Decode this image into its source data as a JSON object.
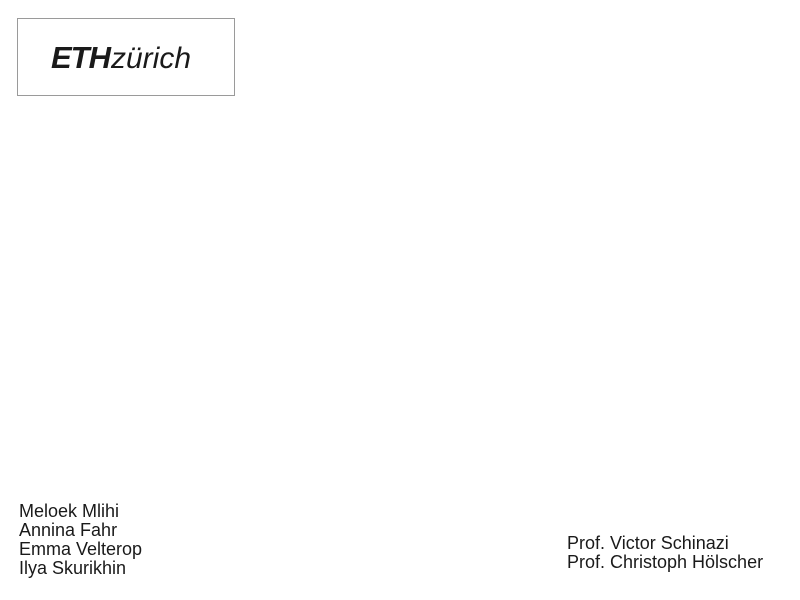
{
  "logo": {
    "wordmark_bold": "ETH",
    "wordmark_light": "zürich"
  },
  "authors": [
    "Meloek Mlihi",
    "Annina Fahr",
    "Emma Velterop",
    "Ilya Skurikhin"
  ],
  "supervisors": [
    "Prof. Victor Schinazi",
    "Prof. Christoph Hölscher"
  ]
}
